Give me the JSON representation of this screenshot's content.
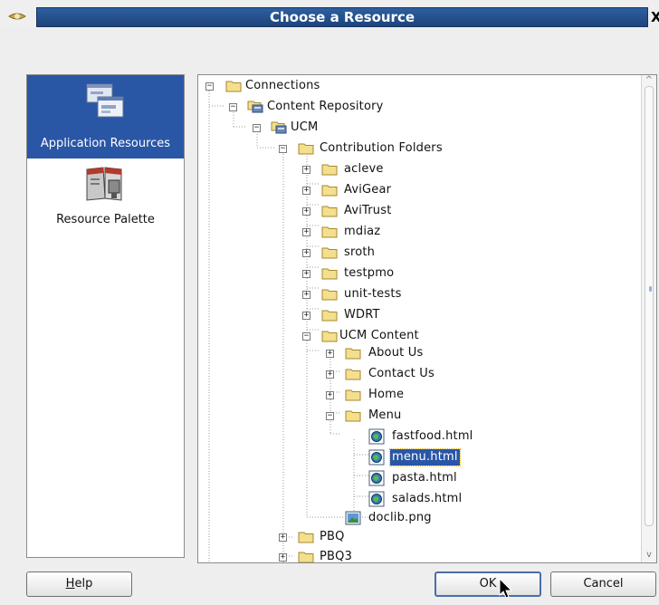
{
  "window": {
    "title": "Choose a Resource",
    "close_glyph": "X"
  },
  "categories": [
    {
      "label": "Application Resources",
      "icon": "application-resources-icon",
      "selected": true
    },
    {
      "label": "Resource Palette",
      "icon": "resource-palette-icon",
      "selected": false
    }
  ],
  "tree": {
    "connections": "Connections",
    "content_repository": "Content Repository",
    "ucm": "UCM",
    "contribution_folders": "Contribution Folders",
    "folders": [
      "acleve",
      "AviGear",
      "AviTrust",
      "mdiaz",
      "sroth",
      "testpmo",
      "unit-tests",
      "WDRT"
    ],
    "ucm_content": "UCM  Content",
    "ucm_content_children": [
      "About Us",
      "Contact Us",
      "Home"
    ],
    "menu": "Menu",
    "menu_files": [
      "fastfood.html",
      "menu.html",
      "pasta.html",
      "salads.html"
    ],
    "selected_file": "menu.html",
    "doclib": "doclib.png",
    "pbq": "PBQ",
    "pbq3": "PBQ3"
  },
  "buttons": {
    "help": "Help",
    "help_mnemonic": "H",
    "help_rest": "elp",
    "ok": "OK",
    "cancel": "Cancel"
  },
  "colors": {
    "selection": "#2a56a6",
    "title_bar": "#1d447c"
  }
}
